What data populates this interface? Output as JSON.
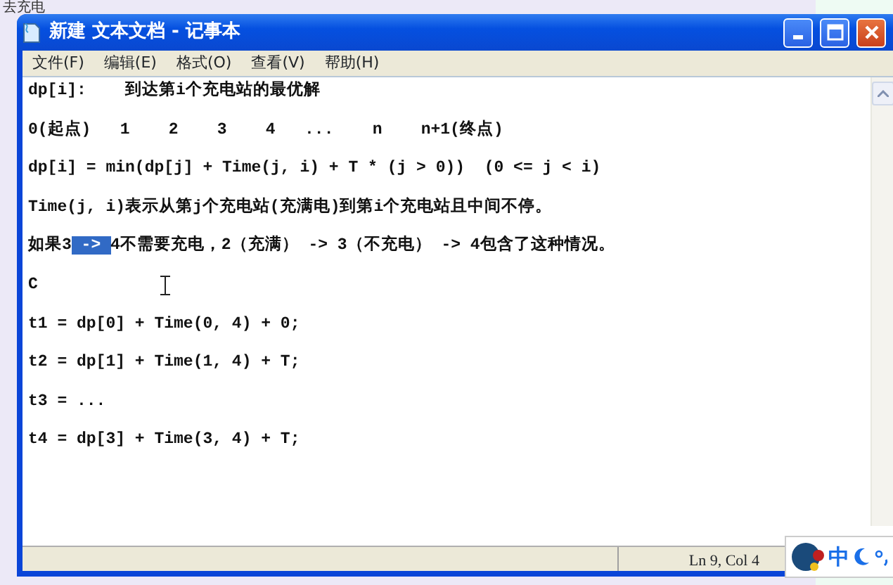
{
  "background": {
    "text": "去充电"
  },
  "window": {
    "title": "新建 文本文档 - 记事本"
  },
  "menu": [
    {
      "label": "文件(F)"
    },
    {
      "label": "编辑(E)"
    },
    {
      "label": "格式(O)"
    },
    {
      "label": "查看(V)"
    },
    {
      "label": "帮助(H)"
    }
  ],
  "editor": {
    "lines": [
      [
        {
          "text": "dp[i]:    到达第i个充电站的最优解",
          "selected": false
        }
      ],
      [
        {
          "text": "0(起点)   1    2    3    4   ...    n    n+1(终点)",
          "selected": false
        }
      ],
      [
        {
          "text": "dp[i] = min(dp[j] + Time(j, i) + T * (j > 0))  (0 <= j < i)",
          "selected": false
        }
      ],
      [
        {
          "text": "Time(j, i)表示从第j个充电站(充满电)到第i个充电站且中间不停。",
          "selected": false
        }
      ],
      [
        {
          "text": "如果3",
          "selected": false
        },
        {
          "text": " -> ",
          "selected": true
        },
        {
          "text": "4不需要充电，2（充满） -> 3（不充电） -> 4包含了这种情况。",
          "selected": false
        }
      ],
      [
        {
          "text": "C",
          "selected": false
        }
      ],
      [
        {
          "text": "t1 = dp[0] + Time(0, 4) + 0;",
          "selected": false
        }
      ],
      [
        {
          "text": "t2 = dp[1] + Time(1, 4) + T;",
          "selected": false
        }
      ],
      [
        {
          "text": "t3 = ...",
          "selected": false
        }
      ],
      [
        {
          "text": "t4 = dp[3] + Time(3, 4) + T;",
          "selected": false
        }
      ]
    ]
  },
  "status_bar": {
    "position": "Ln 9, Col 4"
  },
  "ime_bar": {
    "mode": "中"
  }
}
